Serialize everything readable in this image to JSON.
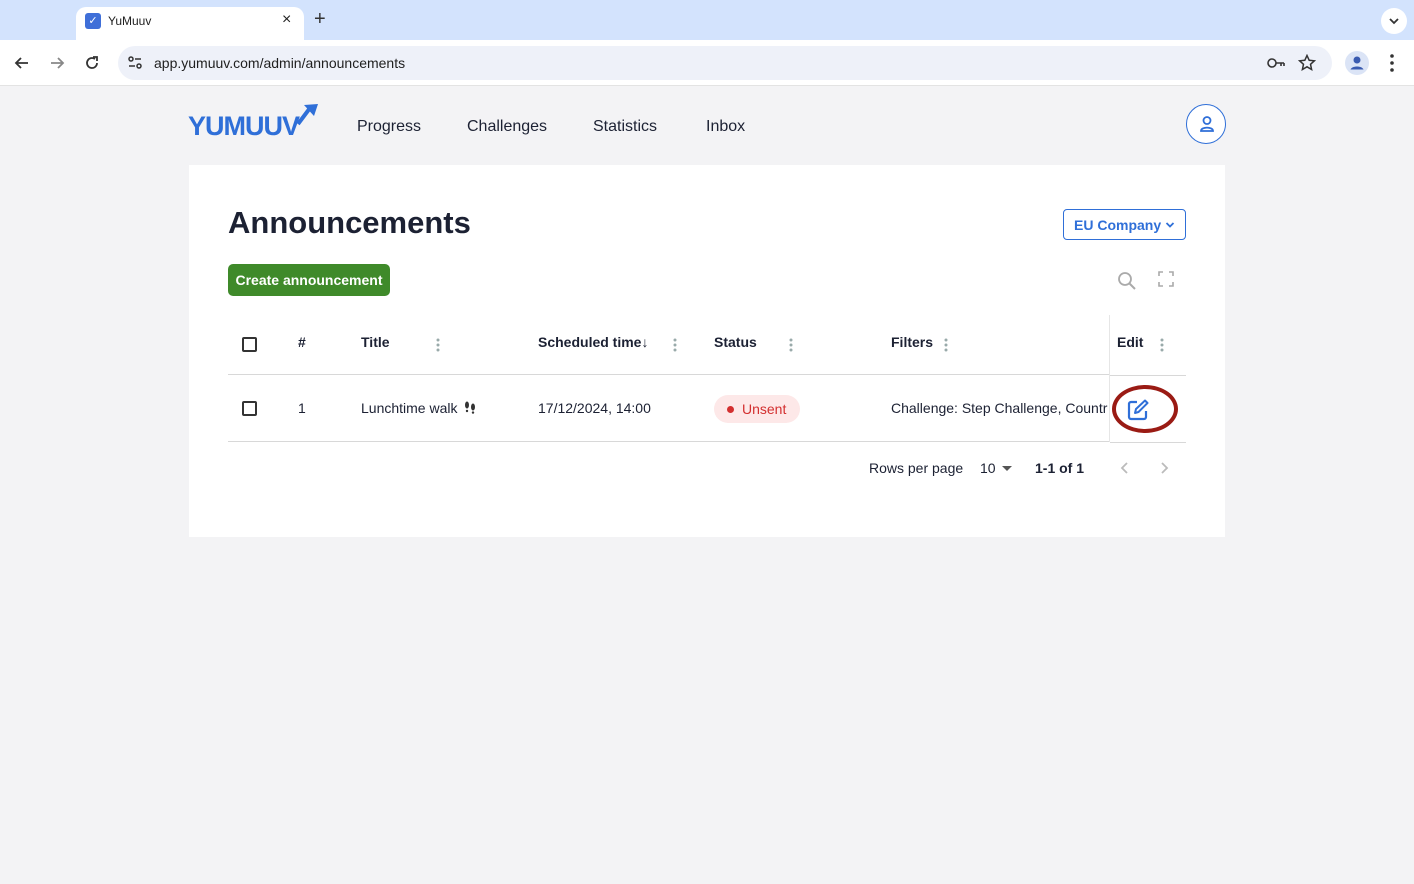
{
  "browser": {
    "tab_title": "YuMuuv",
    "favicon_glyph": "✓",
    "url": "app.yumuuv.com/admin/announcements"
  },
  "app": {
    "logo_text": "YUMUUV",
    "nav": [
      "Progress",
      "Challenges",
      "Statistics",
      "Inbox"
    ],
    "brand_color": "#2f6fd8"
  },
  "page": {
    "title": "Announcements",
    "company": "EU Company",
    "create_label": "Create announcement",
    "create_color": "#3f8a2a"
  },
  "table": {
    "columns": {
      "number": "#",
      "title": "Title",
      "scheduled": "Scheduled time",
      "status": "Status",
      "filters": "Filters",
      "edit": "Edit"
    },
    "sort_indicator": "↓",
    "rows": [
      {
        "number": "1",
        "title": "Lunchtime walk",
        "title_icon": "footprints-icon",
        "scheduled": "17/12/2024, 14:00",
        "status": "Unsent",
        "status_color": "#d32f2f",
        "filters": "Challenge: Step Challenge, Countr"
      }
    ]
  },
  "pagination": {
    "rows_label": "Rows per page",
    "rows_value": "10",
    "range": "1-1 of 1"
  },
  "annotation": {
    "ring_color": "#9a1b14"
  }
}
